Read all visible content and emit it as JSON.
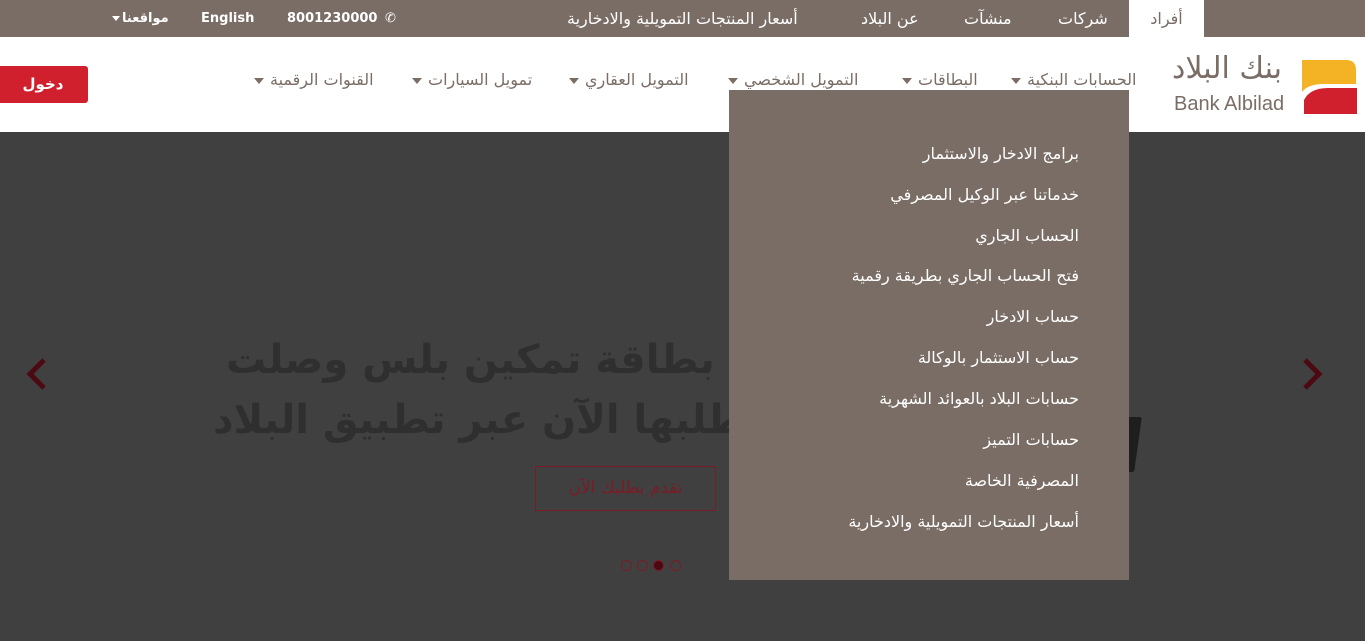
{
  "topbar": {
    "tabs": [
      "أفراد",
      "شركات",
      "منشآت",
      "عن البلاد",
      "أسعار المنتجات التمويلية والادخارية"
    ],
    "phone": "8001230000",
    "language": "English",
    "locations": "مواقعنا"
  },
  "header": {
    "logo_ar": "بنك البلاد",
    "logo_en": "Bank Albilad",
    "nav": [
      "الحسابات البنكية",
      "البطاقات",
      "التمويل الشخصي",
      "التمويل العقاري",
      "تمويل السيارات",
      "القنوات الرقمية"
    ],
    "login_label": "دخول"
  },
  "dropdown": {
    "items": [
      "برامج الادخار والاستثمار",
      "خدماتنا عبر الوكيل المصرفي",
      "الحساب الجاري",
      "فتح الحساب الجاري بطريقة رقمية",
      "حساب الادخار",
      "حساب الاستثمار بالوكالة",
      "حسابات البلاد بالعوائد الشهرية",
      "حسابات التميز",
      "المصرفية الخاصة",
      "أسعار المنتجات التمويلية والادخارية"
    ]
  },
  "hero": {
    "line1": "بطاقة تمكين بلس وصلت",
    "line2": "اطلبها الآن عبر تطبيق البلاد",
    "cta": "تقدم بطلبك الآن",
    "slides_total": 4,
    "slide_active": 3
  },
  "colors": {
    "brand_taupe": "#7a6d66",
    "brand_red": "#d0202e",
    "brand_gold": "#f4b324",
    "hero_bg": "#404040",
    "maroon": "#7a1c26"
  }
}
